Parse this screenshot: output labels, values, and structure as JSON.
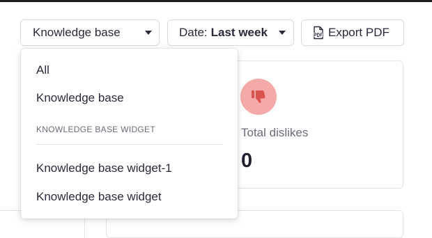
{
  "filters": {
    "source_selected": "Knowledge base",
    "date_prefix": "Date:",
    "date_value": "Last week",
    "export_label": "Export PDF"
  },
  "dropdown": {
    "items": [
      "All",
      "Knowledge base"
    ],
    "section_header": "KNOWLEDGE BASE WIDGET",
    "section_items": [
      "Knowledge base widget-1",
      "Knowledge base widget"
    ]
  },
  "stats": {
    "dislikes_label": "Total dislikes",
    "dislikes_value": "0"
  },
  "icons": {
    "pdf": "pdf-file-icon",
    "dislike": "thumbs-down-icon",
    "caret": "chevron-down-icon"
  },
  "colors": {
    "dislike_circle": "#f5a9a9",
    "dislike_icon": "#d9534f"
  }
}
